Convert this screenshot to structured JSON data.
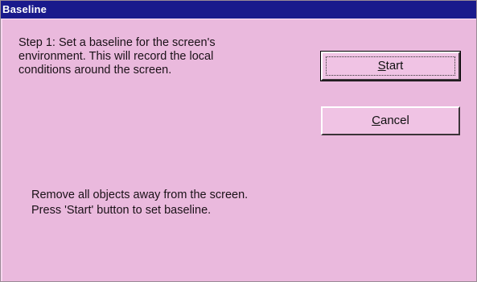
{
  "window": {
    "title": "Baseline"
  },
  "content": {
    "step_text": "Step 1:  Set a baseline for the screen's\nenvironment.  This will record the local\nconditions around the screen.",
    "instruction_line_1": "Remove all objects away from the screen.",
    "instruction_line_2": "Press 'Start' button to set baseline."
  },
  "buttons": {
    "start_mnemonic": "S",
    "start_rest": "tart",
    "cancel_mnemonic": "C",
    "cancel_rest": "ancel"
  },
  "colors": {
    "titlebar": "#1a1a8c",
    "background": "#eab9dd"
  }
}
